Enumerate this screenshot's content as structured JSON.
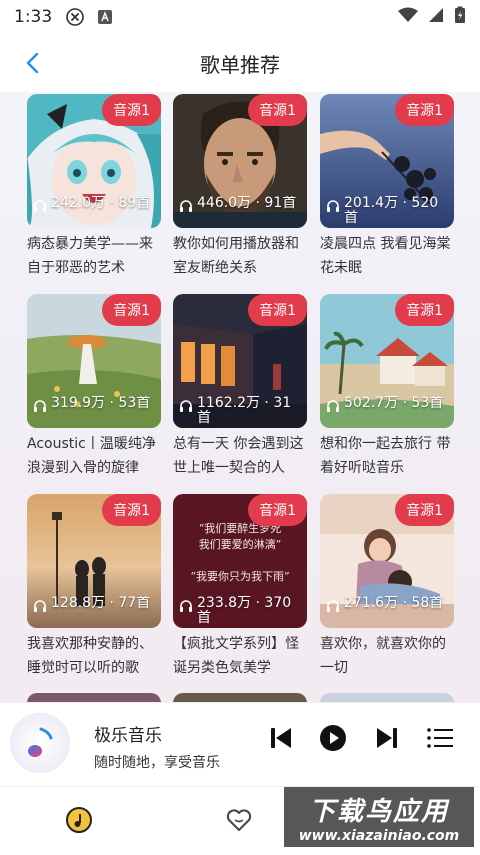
{
  "status_bar": {
    "time": "1:33"
  },
  "header": {
    "title": "歌单推荐"
  },
  "playlists": [
    {
      "badge": "音源1",
      "stats": "242.0万 · 89首",
      "title": "病态暴力美学——来自于邪恶的艺术",
      "cover": "anime-girl-cover"
    },
    {
      "badge": "音源1",
      "stats": "446.0万 · 91首",
      "title": "教你如何用播放器和室友断绝关系",
      "cover": "bearded-man-cover"
    },
    {
      "badge": "音源1",
      "stats": "201.4万 · 520首",
      "title": "凌晨四点 我看见海棠花未眠",
      "cover": "flower-hand-cover"
    },
    {
      "badge": "音源1",
      "stats": "319.9万 · 53首",
      "title": "Acoustic丨温暖纯净 浪漫到入骨的旋律",
      "cover": "meadow-painting-cover"
    },
    {
      "badge": "音源1",
      "stats": "1162.2万 · 31首",
      "title": "总有一天 你会遇到这世上唯一契合的人",
      "cover": "night-train-cover"
    },
    {
      "badge": "音源1",
      "stats": "502.7万 · 53首",
      "title": "想和你一起去旅行 带着好听哒音乐",
      "cover": "seaside-town-cover"
    },
    {
      "badge": "音源1",
      "stats": "128.8万 · 77首",
      "title": "我喜欢那种安静的、睡觉时可以听的歌",
      "cover": "couple-sunset-cover",
      "poster": []
    },
    {
      "badge": "音源1",
      "stats": "233.8万 · 370首",
      "title": "【疯批文学系列】怪诞另类色気美学",
      "cover": "text-poster-cover",
      "poster": [
        "“我们要醉生梦死",
        "我们要爱的淋漓”",
        "“我要你只为我下雨”"
      ]
    },
    {
      "badge": "音源1",
      "stats": "271.6万 · 58首",
      "title": "喜欢你，就喜欢你的一切",
      "cover": "couple-illustration-cover"
    }
  ],
  "player": {
    "app_name": "极乐音乐",
    "slogan": "随时随地，享受音乐"
  },
  "watermark": {
    "cn": "下载鸟应用",
    "url": "www.xiazainiao.com"
  },
  "colors": {
    "accent": "#2b8fe8",
    "badge": "#e13b4c"
  }
}
